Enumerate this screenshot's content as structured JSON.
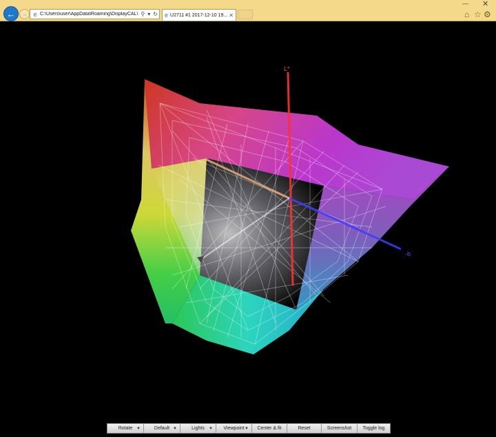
{
  "browser": {
    "address": "C:\\Users\\user\\AppData\\Roaming\\DisplayCAL\\",
    "tab_title": "U2711 #1 2017-12-10 19...",
    "search_icon": "search-icon",
    "refresh_icon": "refresh-icon"
  },
  "axes": {
    "l_label": "L*",
    "b_label": "-b"
  },
  "toolbar": {
    "buttons": [
      {
        "label": "Rotate",
        "dropdown": true
      },
      {
        "label": "Default",
        "dropdown": true
      },
      {
        "label": "Lights",
        "dropdown": true
      },
      {
        "label": "Viewpoint",
        "dropdown": true
      },
      {
        "label": "Center & fit",
        "dropdown": false
      },
      {
        "label": "Reset",
        "dropdown": false
      },
      {
        "label": "Screenshot",
        "dropdown": false
      },
      {
        "label": "Toggle log",
        "dropdown": false
      }
    ]
  },
  "colors": {
    "chrome_bg": "#f5d98a",
    "accent_blue": "#1f78c8",
    "viewport_bg": "#000000"
  }
}
